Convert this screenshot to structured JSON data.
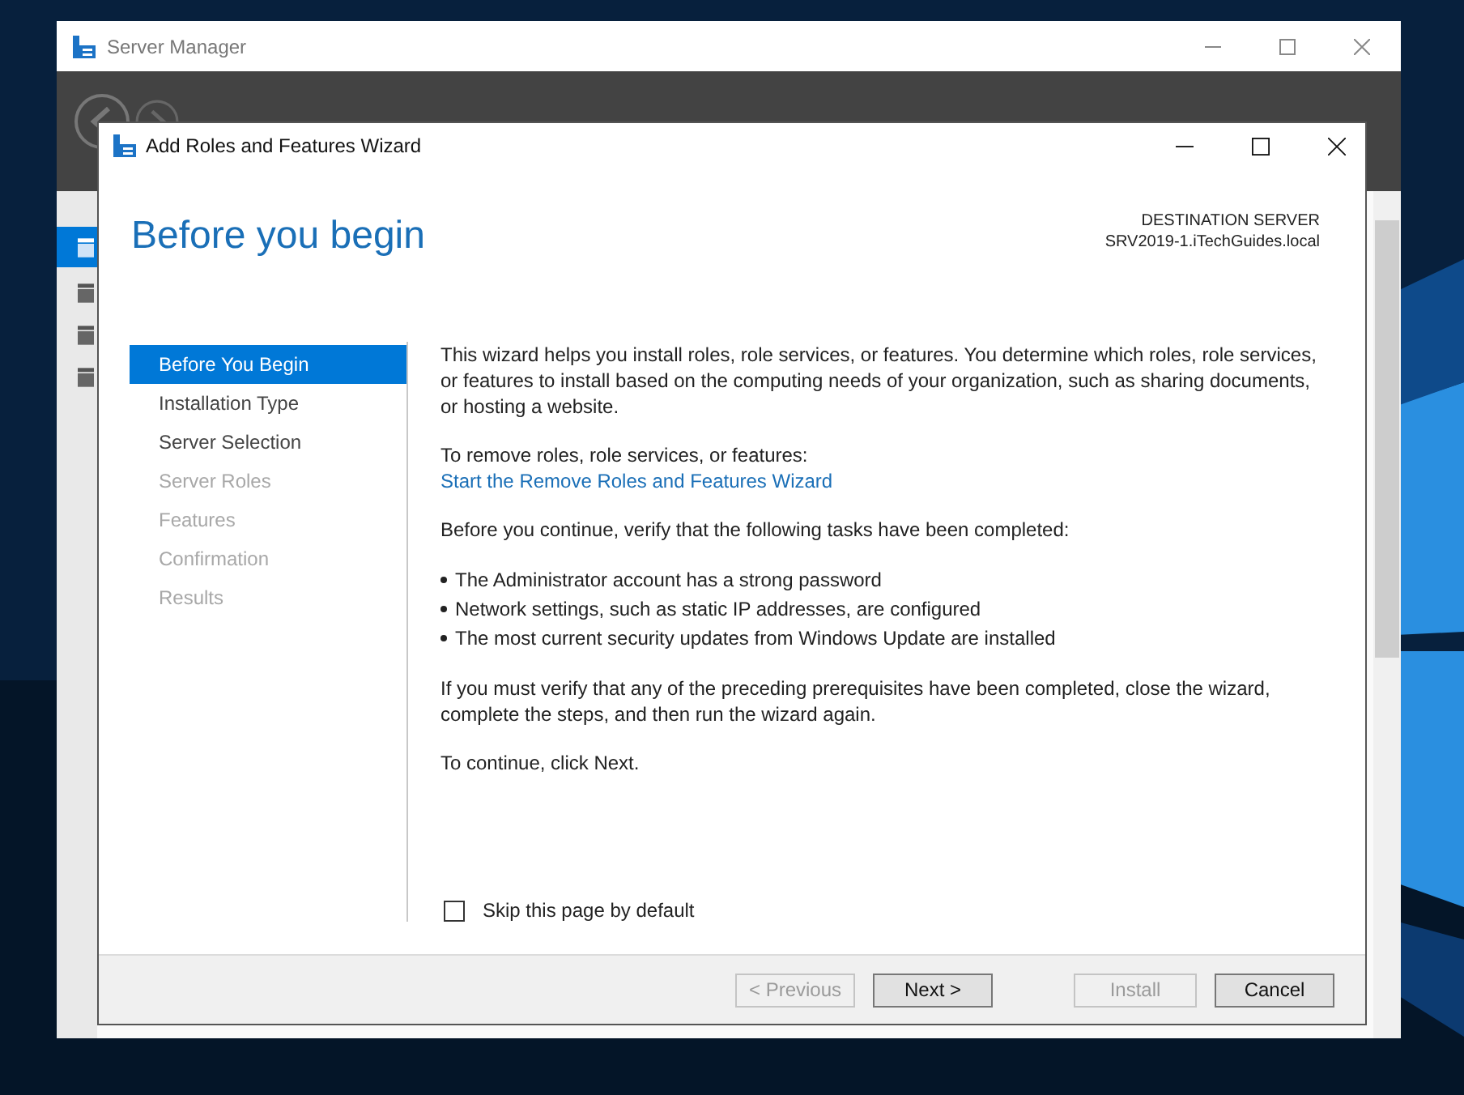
{
  "server_manager": {
    "title": "Server Manager",
    "nav_items": [
      {
        "selected": true
      },
      {
        "selected": false
      },
      {
        "selected": false
      },
      {
        "selected": false
      }
    ]
  },
  "wizard": {
    "title": "Add Roles and Features Wizard",
    "heading": "Before you begin",
    "destination_label": "DESTINATION SERVER",
    "destination_server": "SRV2019-1.iTechGuides.local",
    "steps": [
      {
        "label": "Before You Begin",
        "selected": true,
        "disabled": false
      },
      {
        "label": "Installation Type",
        "selected": false,
        "disabled": false
      },
      {
        "label": "Server Selection",
        "selected": false,
        "disabled": false
      },
      {
        "label": "Server Roles",
        "selected": false,
        "disabled": true
      },
      {
        "label": "Features",
        "selected": false,
        "disabled": true
      },
      {
        "label": "Confirmation",
        "selected": false,
        "disabled": true
      },
      {
        "label": "Results",
        "selected": false,
        "disabled": true
      }
    ],
    "intro": "This wizard helps you install roles, role services, or features. You determine which roles, role services, or features to install based on the computing needs of your organization, such as sharing documents, or hosting a website.",
    "remove_prompt": "To remove roles, role services, or features:",
    "remove_link": "Start the Remove Roles and Features Wizard",
    "verify_text": "Before you continue, verify that the following tasks have been completed:",
    "bullets": [
      "The Administrator account has a strong password",
      "Network settings, such as static IP addresses, are configured",
      "The most current security updates from Windows Update are installed"
    ],
    "prereq_text": "If you must verify that any of the preceding prerequisites have been completed, close the wizard, complete the steps, and then run the wizard again.",
    "continue_text": "To continue, click Next.",
    "skip": {
      "label": "Skip this page by default",
      "checked": false
    },
    "buttons": [
      {
        "label": "< Previous",
        "disabled": true
      },
      {
        "label": "Next >",
        "disabled": false
      },
      {
        "label": "Install",
        "disabled": true
      },
      {
        "label": "Cancel",
        "disabled": false
      }
    ]
  }
}
